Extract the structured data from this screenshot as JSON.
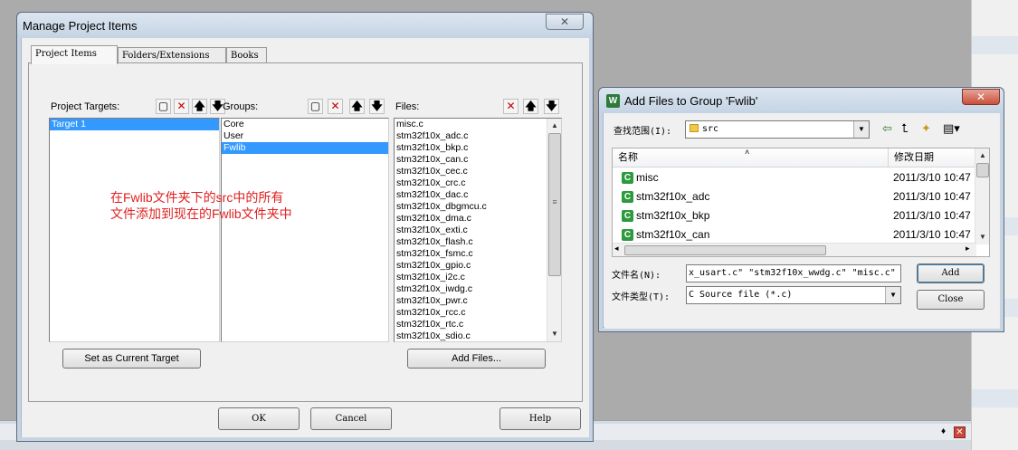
{
  "main_dialog": {
    "title": "Manage Project Items",
    "close_glyph": "✕",
    "tabs": [
      "Project Items",
      "Folders/Extensions",
      "Books"
    ],
    "targets": {
      "header": "Project Targets:",
      "items": [
        "Target 1"
      ],
      "selected": "Target 1"
    },
    "groups": {
      "header": "Groups:",
      "items": [
        "Core",
        "User",
        "Fwlib"
      ],
      "selected": "Fwlib"
    },
    "files": {
      "header": "Files:",
      "items": [
        "misc.c",
        "stm32f10x_adc.c",
        "stm32f10x_bkp.c",
        "stm32f10x_can.c",
        "stm32f10x_cec.c",
        "stm32f10x_crc.c",
        "stm32f10x_dac.c",
        "stm32f10x_dbgmcu.c",
        "stm32f10x_dma.c",
        "stm32f10x_exti.c",
        "stm32f10x_flash.c",
        "stm32f10x_fsmc.c",
        "stm32f10x_gpio.c",
        "stm32f10x_i2c.c",
        "stm32f10x_iwdg.c",
        "stm32f10x_pwr.c",
        "stm32f10x_rcc.c",
        "stm32f10x_rtc.c",
        "stm32f10x_sdio.c"
      ]
    },
    "icons": {
      "new": "▢",
      "delete": "✕",
      "up": "🡅",
      "down": "🡇",
      "scroll_up": "▲",
      "scroll_down": "▼",
      "grip": "≡"
    },
    "buttons": {
      "set_target": "Set as Current Target",
      "add_files": "Add Files...",
      "ok": "OK",
      "cancel": "Cancel",
      "help": "Help"
    },
    "annotation": [
      "在Fwlib文件夹下的src中的所有",
      "文件添加到现在的Fwlib文件夹中"
    ],
    "colors": {
      "selection": "#3399ff",
      "annotation": "#e02020",
      "delete_icon": "#c80000"
    }
  },
  "add_dialog": {
    "title": "Add Files to Group 'Fwlib'",
    "app_icon": "W",
    "close_glyph": "✕",
    "look_in_label": "查找范围(I):",
    "look_in_value": "src",
    "toolbar_icons": {
      "back": "⇦",
      "up_folder": "⮤",
      "new_folder": "✦",
      "view_menu": "▤▾"
    },
    "columns": {
      "name": "名称",
      "date": "修改日期",
      "sort": "˄"
    },
    "files": [
      {
        "name": "misc",
        "date": "2011/3/10 10:47"
      },
      {
        "name": "stm32f10x_adc",
        "date": "2011/3/10 10:47"
      },
      {
        "name": "stm32f10x_bkp",
        "date": "2011/3/10 10:47"
      },
      {
        "name": "stm32f10x_can",
        "date": "2011/3/10 10:47"
      }
    ],
    "file_icon": "C",
    "hscroll": {
      "left": "◂",
      "right": "▸"
    },
    "filename_label": "文件名(N):",
    "filename_value": "x_usart.c\" \"stm32f10x_wwdg.c\" \"misc.c\"",
    "filetype_label": "文件类型(T):",
    "filetype_value": "C Source file (*.c)",
    "buttons": {
      "add": "Add",
      "close": "Close"
    }
  },
  "background": {
    "pin": "♦",
    "close": "✕"
  }
}
